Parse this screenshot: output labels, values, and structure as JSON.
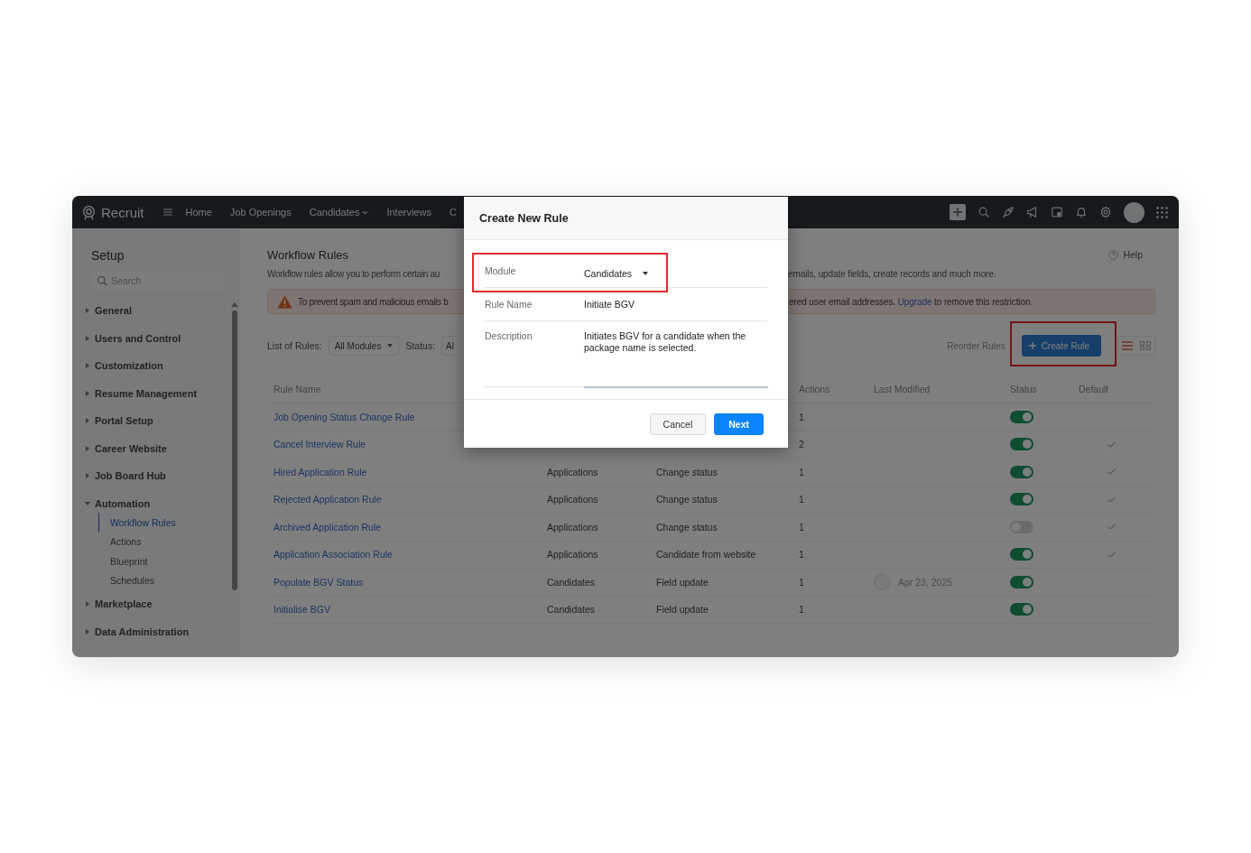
{
  "topbar": {
    "app_name": "Recruit",
    "nav": [
      {
        "label": "Home",
        "dropdown": false
      },
      {
        "label": "Job Openings",
        "dropdown": false
      },
      {
        "label": "Candidates",
        "dropdown": true
      },
      {
        "label": "Interviews",
        "dropdown": false
      },
      {
        "label": "C",
        "dropdown": false
      }
    ]
  },
  "sidebar": {
    "title": "Setup",
    "search": {
      "placeholder": "Search"
    },
    "items": [
      {
        "label": "General",
        "expanded": false
      },
      {
        "label": "Users and Control",
        "expanded": false
      },
      {
        "label": "Customization",
        "expanded": false
      },
      {
        "label": "Resume Management",
        "expanded": false
      },
      {
        "label": "Portal Setup",
        "expanded": false
      },
      {
        "label": "Career Website",
        "expanded": false
      },
      {
        "label": "Job Board Hub",
        "expanded": false
      },
      {
        "label": "Automation",
        "expanded": true,
        "children": [
          {
            "label": "Workflow Rules",
            "selected": true
          },
          {
            "label": "Actions",
            "selected": false
          },
          {
            "label": "Blueprint",
            "selected": false
          },
          {
            "label": "Schedules",
            "selected": false
          }
        ]
      },
      {
        "label": "Marketplace",
        "expanded": false
      },
      {
        "label": "Data Administration",
        "expanded": false
      }
    ]
  },
  "page": {
    "title": "Workflow Rules",
    "help": "Help",
    "description_left": "Workflow rules allow you to perform certain au",
    "description_right": "emails, update fields, create records and much more.",
    "banner": {
      "text_left": "To prevent spam and malicious emails b",
      "text_right_before": "ered user email addresses.",
      "link": "Upgrade",
      "text_right_after": "to remove this restriction."
    },
    "filters": {
      "list_label": "List of Rules:",
      "module_filter": "All Modules",
      "status_label": "Status:",
      "status_filter": "Al"
    },
    "reorder": "Reorder Rules",
    "create_rule": {
      "label": "Create Rule",
      "highlighted": true
    }
  },
  "table": {
    "headers": {
      "rule_name": "Rule Name",
      "actions": "Actions",
      "last_modified": "Last Modified",
      "status": "Status",
      "default": "Default"
    },
    "rows": [
      {
        "name": "Job Opening Status Change Rule",
        "actions": "1",
        "on": true,
        "default": false
      },
      {
        "name": "Cancel Interview Rule",
        "actions": "2",
        "on": true,
        "default": true
      },
      {
        "name": "Hired Application Rule",
        "module": "Applications",
        "trigger": "Change status",
        "actions": "1",
        "on": true,
        "default": true
      },
      {
        "name": "Rejected Application Rule",
        "module": "Applications",
        "trigger": "Change status",
        "actions": "1",
        "on": true,
        "default": true
      },
      {
        "name": "Archived Application Rule",
        "module": "Applications",
        "trigger": "Change status",
        "actions": "1",
        "on": false,
        "default": true
      },
      {
        "name": "Application Association Rule",
        "module": "Applications",
        "trigger": "Candidate from website",
        "actions": "1",
        "on": true,
        "default": true
      },
      {
        "name": "Populate BGV Status",
        "module": "Candidates",
        "trigger": "Field update",
        "actions": "1",
        "last_modified": "Apr 23, 2025",
        "on": true,
        "default": false
      },
      {
        "name": "Initialise BGV",
        "module": "Candidates",
        "trigger": "Field update",
        "actions": "1",
        "on": true,
        "default": false
      }
    ]
  },
  "modal": {
    "title": "Create New Rule",
    "fields": [
      {
        "kind": "select",
        "label": "Module",
        "value": "Candidates",
        "highlighted": true
      },
      {
        "kind": "text",
        "label": "Rule Name",
        "value": "Initiate BGV",
        "highlighted": false
      },
      {
        "kind": "textarea",
        "label": "Description",
        "value": "Initiates BGV for a candidate when the package name is selected.",
        "highlighted": false
      }
    ],
    "buttons": [
      {
        "label": "Cancel",
        "primary": false
      },
      {
        "label": "Next",
        "primary": true
      }
    ]
  }
}
